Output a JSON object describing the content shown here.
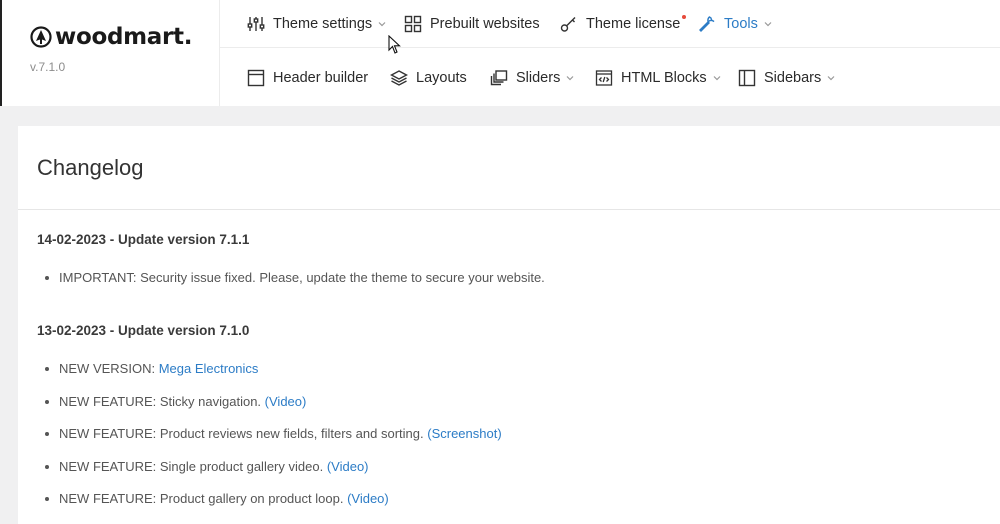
{
  "brand": {
    "logo_text": "woodmart.",
    "version": "v.7.1.0"
  },
  "nav": {
    "row1": [
      {
        "label": "Theme settings",
        "icon": "sliders-icon",
        "dropdown": true
      },
      {
        "label": "Prebuilt websites",
        "icon": "grid-icon",
        "dropdown": false
      },
      {
        "label": "Theme license",
        "icon": "key-icon",
        "dropdown": false,
        "notification": true
      },
      {
        "label": "Tools",
        "icon": "wrench-icon",
        "dropdown": true,
        "active": true
      }
    ],
    "row2": [
      {
        "label": "Header builder",
        "icon": "header-icon",
        "dropdown": false
      },
      {
        "label": "Layouts",
        "icon": "layers-icon",
        "dropdown": false
      },
      {
        "label": "Sliders",
        "icon": "slides-icon",
        "dropdown": true
      },
      {
        "label": "HTML Blocks",
        "icon": "code-icon",
        "dropdown": true
      },
      {
        "label": "Sidebars",
        "icon": "sidebar-icon",
        "dropdown": true
      }
    ]
  },
  "colors": {
    "accent": "#2c7cc6",
    "notification": "#e64b3b",
    "background": "#f0f0f1"
  },
  "changelog": {
    "title": "Changelog",
    "entries": [
      {
        "date": "14-02-2023 - Update version 7.1.1",
        "items": [
          {
            "text": "IMPORTANT: Security issue fixed. Please, update the theme to secure your website.",
            "link": ""
          }
        ]
      },
      {
        "date": "13-02-2023 - Update version 7.1.0",
        "items": [
          {
            "text": "NEW VERSION:",
            "link": "Mega Electronics"
          },
          {
            "text": "NEW FEATURE: Sticky navigation.",
            "link": "(Video)"
          },
          {
            "text": "NEW FEATURE: Product reviews new fields, filters and sorting.",
            "link": "(Screenshot)"
          },
          {
            "text": "NEW FEATURE: Single product gallery video.",
            "link": "(Video)"
          },
          {
            "text": "NEW FEATURE: Product gallery on product loop.",
            "link": "(Video)"
          }
        ]
      }
    ]
  }
}
